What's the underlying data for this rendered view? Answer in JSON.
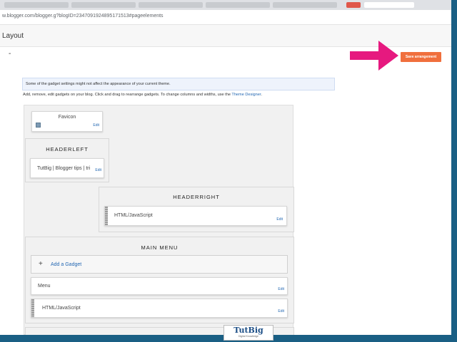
{
  "browser": {
    "url": "w.blogger.com/blogger.g?blogID=2347091924895171513#pageelements"
  },
  "page": {
    "title": "Layout",
    "dash": "-"
  },
  "toolbar": {
    "save_label": "Save arrangement"
  },
  "notice": "Some of the gadget settings might not affect the appearance of your current theme.",
  "info": {
    "text": "Add, remove, edit gadgets on your blog. Click and drag to rearrange gadgets. To change columns and widths, use the ",
    "link": "Theme Designer",
    "suffix": "."
  },
  "favicon": {
    "title": "Favicon",
    "edit": "Edit"
  },
  "headerleft": {
    "title": "HEADERLEFT",
    "gadget": "TutBig | Blogger tips | tri",
    "edit": "Edit"
  },
  "headerright": {
    "title": "HEADERRIGHT",
    "gadget": "HTML/JavaScript",
    "edit": "Edit"
  },
  "mainmenu": {
    "title": "MAIN MENU",
    "add_gadget": "Add a Gadget",
    "plus": "+",
    "gadgets": [
      {
        "title": "Menu",
        "edit": "Edit"
      },
      {
        "title": "HTML/JavaScript",
        "edit": "Edit"
      }
    ]
  },
  "logo": {
    "main": "TutBig",
    "sub": "Digital Knowledge"
  },
  "colors": {
    "save_button": "#f06f3d",
    "arrow": "#e6197f",
    "link": "#2468b3",
    "frame": "#1a5f84"
  }
}
